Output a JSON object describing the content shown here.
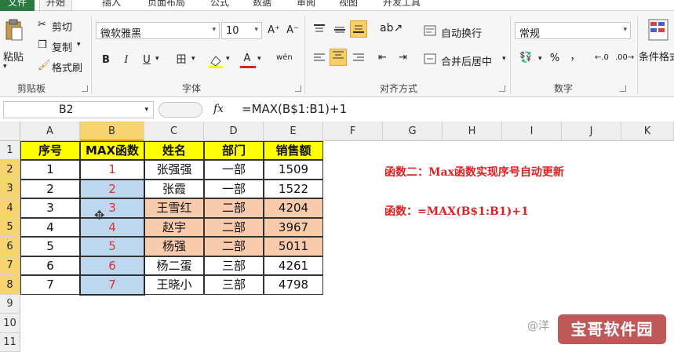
{
  "tabs": [
    {
      "label": "文件",
      "active": false
    },
    {
      "label": "开始",
      "active": true
    },
    {
      "label": "插入",
      "active": false
    },
    {
      "label": "页面布局",
      "active": false
    },
    {
      "label": "公式",
      "active": false
    },
    {
      "label": "数据",
      "active": false
    },
    {
      "label": "审阅",
      "active": false
    },
    {
      "label": "视图",
      "active": false
    },
    {
      "label": "开发工具",
      "active": false
    }
  ],
  "clipboard": {
    "paste": "粘贴",
    "cut": "剪切",
    "copy": "复制",
    "copy_dd": "▾",
    "format_painter": "格式刷",
    "label": "剪贴板"
  },
  "font": {
    "name": "微软雅黑",
    "size": "10",
    "grow": "A⁺",
    "shrink": "A⁻",
    "bold": "B",
    "italic": "I",
    "underline": "U",
    "underline_dd": "▾",
    "border": "田",
    "fill_dd": "▾",
    "fontcolor": "A",
    "fontcolor_dd": "▾",
    "phonetic": "wén",
    "label": "字体"
  },
  "align": {
    "wrap": "自动换行",
    "merge": "合并后居中",
    "merge_dd": "▾",
    "label": "对齐方式"
  },
  "number": {
    "format": "常规",
    "percent": "%",
    "comma": "，",
    "label": "数字"
  },
  "styles": {
    "cond": "条件格式"
  },
  "formula_bar": {
    "name_box": "B2",
    "fx": "fx",
    "formula": "=MAX(B$1:B1)+1"
  },
  "columns": [
    "A",
    "B",
    "C",
    "D",
    "E",
    "F",
    "G",
    "H",
    "I",
    "J",
    "K"
  ],
  "rows": [
    "1",
    "2",
    "3",
    "4",
    "5",
    "6",
    "7",
    "8",
    "9",
    "10",
    "11"
  ],
  "table": {
    "headers": [
      "序号",
      "MAX函数",
      "姓名",
      "部门",
      "销售额"
    ],
    "data": [
      [
        "1",
        "1",
        "张强强",
        "一部",
        "1509"
      ],
      [
        "2",
        "2",
        "张霞",
        "一部",
        "1522"
      ],
      [
        "3",
        "3",
        "王雪红",
        "二部",
        "4204"
      ],
      [
        "4",
        "4",
        "赵宇",
        "二部",
        "3967"
      ],
      [
        "5",
        "5",
        "杨强",
        "二部",
        "5011"
      ],
      [
        "6",
        "6",
        "杨二蛋",
        "三部",
        "4261"
      ],
      [
        "7",
        "7",
        "王晓小",
        "三部",
        "4798"
      ]
    ]
  },
  "notes": {
    "title": "函数二：Max函数实现序号自动更新",
    "formula": "函数：=MAX(B$1:B1)+1"
  },
  "watermark": {
    "left": "@洋",
    "badge": "宝哥软件园"
  },
  "colors": {
    "header_fill": "#ffff00",
    "orange_fill": "#f8cbad",
    "blue_fill": "#bdd7ee",
    "note_red": "#e02020",
    "file_tab": "#2a7a3f"
  }
}
